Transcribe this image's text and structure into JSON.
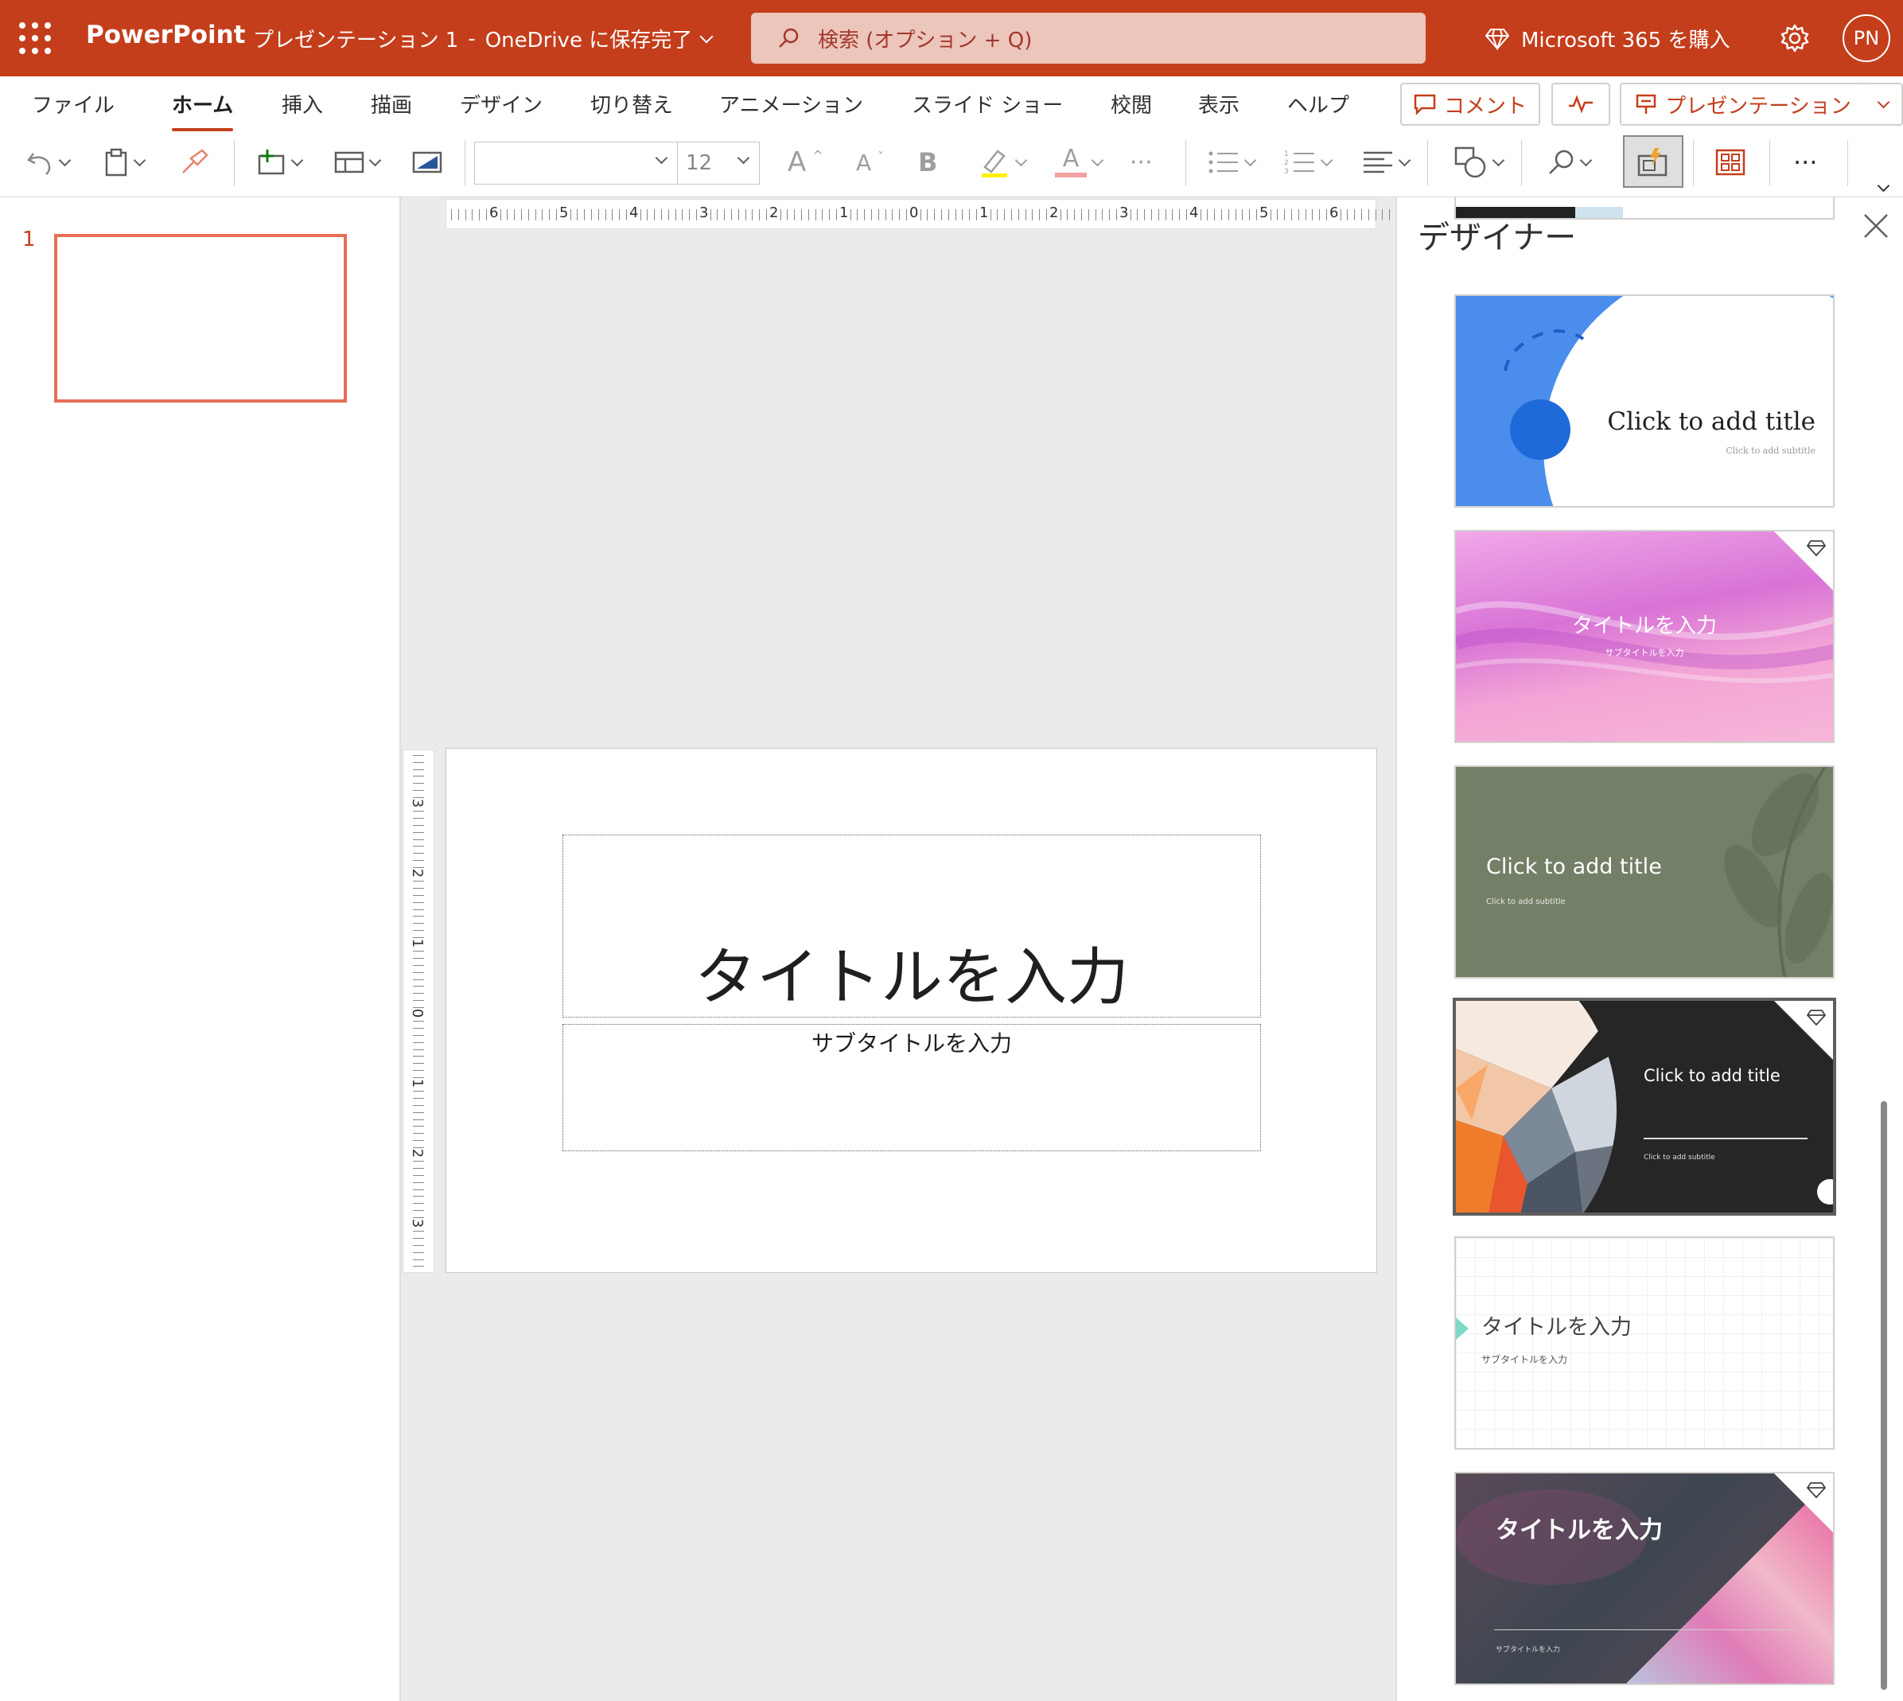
{
  "titlebar": {
    "app_name": "PowerPoint",
    "doc_name": "プレゼンテーション 1",
    "separator": "-",
    "save_status": "OneDrive に保存完了",
    "search_placeholder": "検索 (オプション + Q)",
    "buy_label": "Microsoft 365 を購入",
    "avatar_initials": "PN",
    "bar_color": "#c43e1c"
  },
  "ribbon": {
    "tabs": [
      "ファイル",
      "ホーム",
      "挿入",
      "描画",
      "デザイン",
      "切り替え",
      "アニメーション",
      "スライド ショー",
      "校閲",
      "表示",
      "ヘルプ"
    ],
    "active_tab": "ホーム",
    "comment_label": "コメント",
    "present_label": "プレゼンテーション",
    "font_name": "",
    "font_size": "12",
    "grow_font": "A",
    "shrink_font": "A",
    "bold": "B",
    "font_color": "A",
    "more": "···"
  },
  "thumbnails": {
    "slide_number": "1"
  },
  "ruler": {
    "h_labels": [
      "6",
      "5",
      "4",
      "3",
      "2",
      "1",
      "0",
      "1",
      "2",
      "3",
      "4",
      "5",
      "6"
    ],
    "v_labels": [
      "3",
      "2",
      "1",
      "0",
      "1",
      "2",
      "3"
    ]
  },
  "slide": {
    "title": "タイトルを入力",
    "subtitle": "サブタイトルを入力"
  },
  "designer": {
    "title": "デザイナー",
    "cards": [
      {
        "title": "Click to add title",
        "subtitle": "Click to add subtitle"
      },
      {
        "title": "タイトルを入力",
        "subtitle": "サブタイトルを入力",
        "premium": true
      },
      {
        "title": "Click to add title",
        "subtitle": "Click to add subtitle"
      },
      {
        "title": "Click to add title",
        "subtitle": "Click to add subtitle",
        "premium": true,
        "selected": true
      },
      {
        "title": "タイトルを入力",
        "subtitle": "サブタイトルを入力"
      },
      {
        "title": "タイトルを入力",
        "subtitle": "サブタイトルを入力",
        "premium": true
      }
    ]
  }
}
